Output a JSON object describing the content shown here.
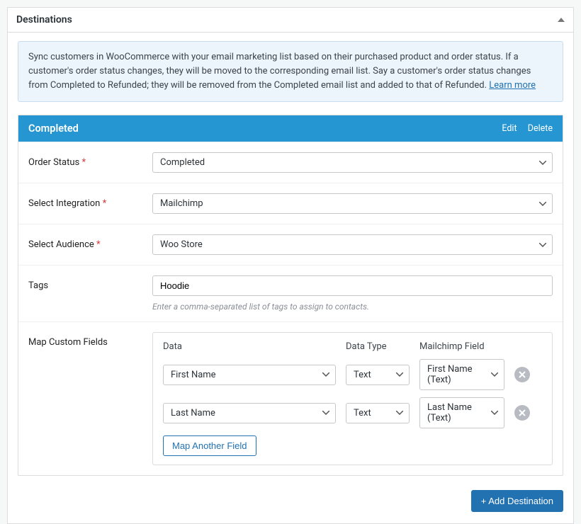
{
  "panel": {
    "title": "Destinations",
    "info_text": "Sync customers in WooCommerce with your email marketing list based on their purchased product and order status. If a customer's order status changes, they will be moved to the corresponding email list. Say a customer's order status changes from Completed to Refunded; they will be removed from the Completed email list and added to that of Refunded. ",
    "learn_more": "Learn more"
  },
  "card": {
    "header_title": "Completed",
    "edit": "Edit",
    "delete": "Delete",
    "fields": {
      "order_status": {
        "label": "Order Status",
        "required": true,
        "value": "Completed"
      },
      "select_integration": {
        "label": "Select Integration",
        "required": true,
        "value": "Mailchimp"
      },
      "select_audience": {
        "label": "Select Audience",
        "required": true,
        "value": "Woo Store"
      },
      "tags": {
        "label": "Tags",
        "value": "Hoodie",
        "hint": "Enter a comma-separated list of tags to assign to contacts."
      },
      "map_custom_fields": {
        "label": "Map Custom Fields"
      }
    },
    "map": {
      "headers": {
        "data": "Data",
        "data_type": "Data Type",
        "mf": "Mailchimp Field"
      },
      "rows": [
        {
          "data": "First Name",
          "type": "Text",
          "mf": "First Name (Text)"
        },
        {
          "data": "Last Name",
          "type": "Text",
          "mf": "Last Name (Text)"
        }
      ],
      "map_another": "Map Another Field"
    }
  },
  "add_destination": "+ Add Destination"
}
